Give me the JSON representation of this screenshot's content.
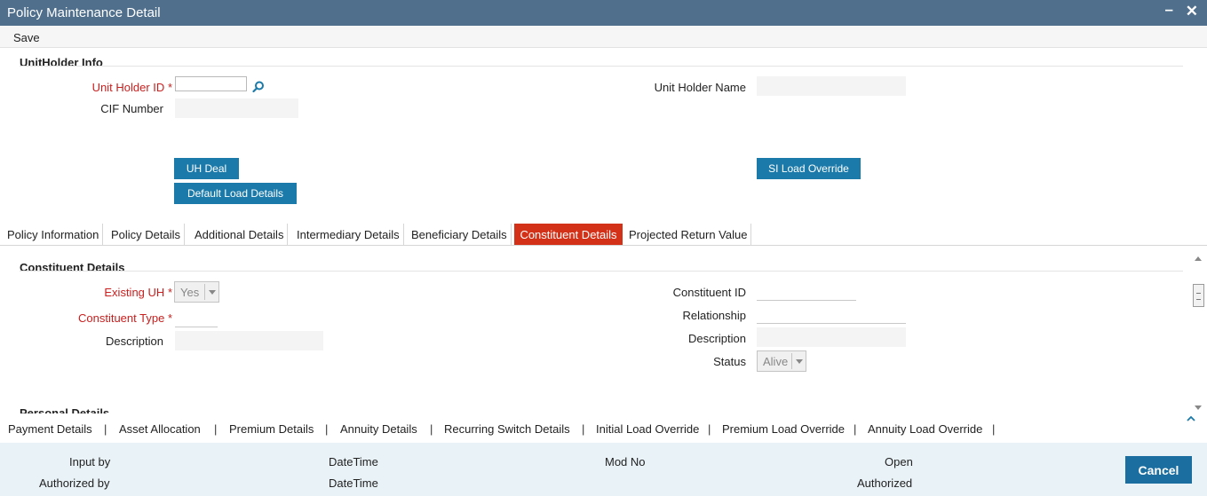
{
  "window": {
    "title": "Policy Maintenance Detail",
    "minimize": "–",
    "close": "✕"
  },
  "menu": {
    "save_label": "Save"
  },
  "unitholder": {
    "section_title": "UnitHolder Info",
    "uh_id_label": "Unit Holder ID",
    "uh_id_value": "",
    "uh_name_label": "Unit Holder Name",
    "uh_name_value": "",
    "cif_label": "CIF Number",
    "cif_value": "",
    "btn_uh_deal": "UH Deal",
    "btn_default_load": "Default Load Details",
    "btn_si_load": "SI Load Override"
  },
  "tabs": [
    {
      "label": "Policy Information"
    },
    {
      "label": "Policy Details"
    },
    {
      "label": "Additional Details"
    },
    {
      "label": "Intermediary Details"
    },
    {
      "label": "Beneficiary Details"
    },
    {
      "label": "Constituent Details",
      "active": true
    },
    {
      "label": "Projected Return Value"
    }
  ],
  "constituent": {
    "section_title": "Constituent Details",
    "existing_uh_label": "Existing UH",
    "existing_uh_value": "Yes",
    "constituent_type_label": "Constituent Type",
    "constituent_type_value": "",
    "description_label": "Description",
    "description_value": "",
    "constituent_id_label": "Constituent ID",
    "constituent_id_value": "",
    "relationship_label": "Relationship",
    "relationship_value": "",
    "description2_label": "Description",
    "description2_value": "",
    "status_label": "Status",
    "status_value": "Alive",
    "personal_section_title": "Personal Details"
  },
  "sub_links": [
    "Payment Details",
    "Asset Allocation",
    "Premium Details",
    "Annuity Details",
    "Recurring Switch Details",
    "Initial Load Override",
    "Premium Load Override",
    "Annuity Load Override"
  ],
  "separator": "|",
  "footer": {
    "input_by": "Input by",
    "datetime1": "DateTime",
    "mod_no": "Mod No",
    "open": "Open",
    "authorized_by": "Authorized by",
    "datetime2": "DateTime",
    "authorized": "Authorized",
    "cancel_label": "Cancel"
  },
  "colors": {
    "titlebar": "#4f6f8c",
    "button": "#1b7aa9",
    "active_tab": "#d33118",
    "required": "#c8201f",
    "footer": "#e9f2f7"
  }
}
